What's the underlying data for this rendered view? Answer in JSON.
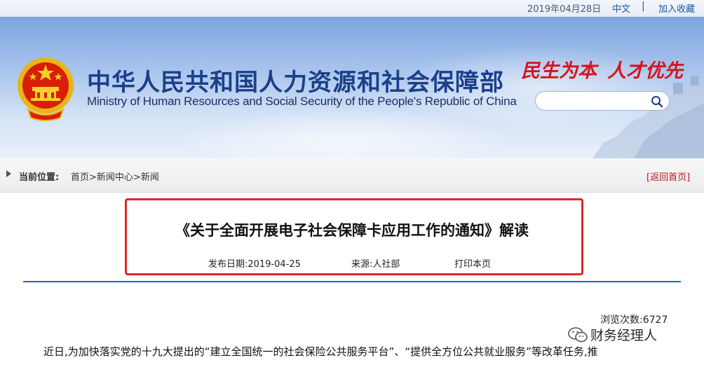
{
  "topbar": {
    "date": "2019年04月28日",
    "lang_label": "中文",
    "separator": "|",
    "favorite_label": "加入收藏"
  },
  "header": {
    "title_zh": "中华人民共和国人力资源和社会保障部",
    "title_en": "Ministry of Human Resources and Social Security of the People's Republic of China",
    "slogan_left": "民生为本",
    "slogan_right": "人才优先",
    "search": {
      "placeholder": "",
      "value": ""
    }
  },
  "breadcrumb": {
    "label": "当前位置:",
    "items": [
      "首页",
      ">",
      "新闻中心",
      ">",
      "新闻"
    ],
    "back_label": "[返回首页]"
  },
  "article": {
    "title": "《关于全面开展电子社会保障卡应用工作的通知》解读",
    "publish_date": "发布日期:2019-04-25",
    "source": "来源:人社部",
    "print_label": "打印本页",
    "views": "浏览次数:6727",
    "paragraph_start": "近日,为加快落实党的十九大提出的“建立全国统一的社会保险公共服务平台”、“提供全方位公共就业服务”等改革任务,推"
  },
  "watermark": {
    "text": "财务经理人"
  },
  "colors": {
    "brand_blue": "#1b3f8a",
    "slogan_red": "#d8121c",
    "highlight_red": "#e0262b",
    "rule_blue": "#2a67b3",
    "link_blue": "#1f56a9"
  }
}
